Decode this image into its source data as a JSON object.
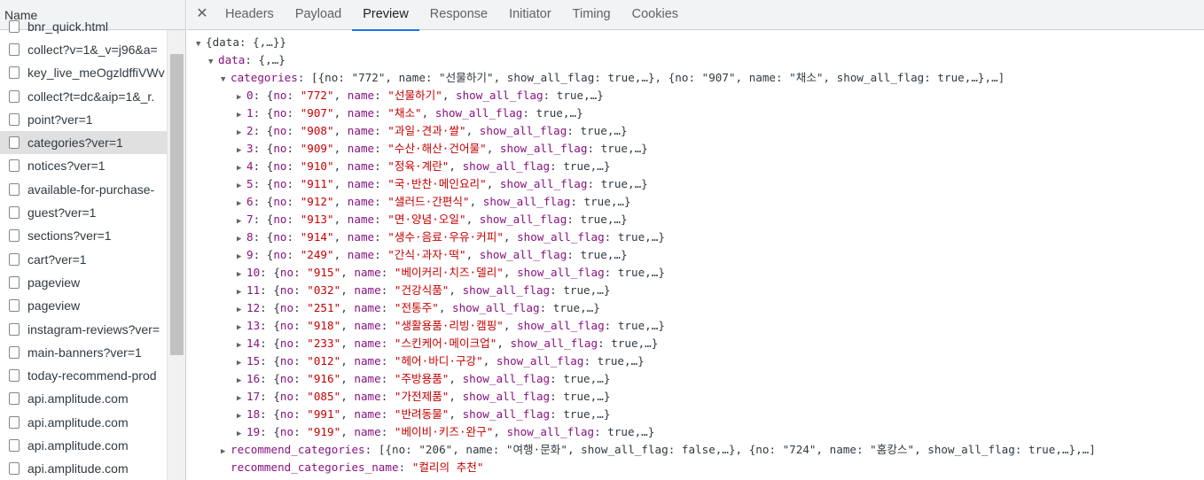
{
  "sidebar": {
    "header": "Name",
    "requests": [
      "bnr_quick.html",
      "collect?v=1&_v=j96&a=",
      "key_live_meOgzldffiVWv",
      "collect?t=dc&aip=1&_r.",
      "point?ver=1",
      "categories?ver=1",
      "notices?ver=1",
      "available-for-purchase-",
      "guest?ver=1",
      "sections?ver=1",
      "cart?ver=1",
      "pageview",
      "pageview",
      "instagram-reviews?ver=",
      "main-banners?ver=1",
      "today-recommend-prod",
      "api.amplitude.com",
      "api.amplitude.com",
      "api.amplitude.com",
      "api.amplitude.com"
    ],
    "selected_index": 5
  },
  "tabs": {
    "close": "✕",
    "items": [
      "Headers",
      "Payload",
      "Preview",
      "Response",
      "Initiator",
      "Timing",
      "Cookies"
    ],
    "active": "Preview"
  },
  "preview": {
    "root": "{data: {,…}}",
    "data_key": "data",
    "data_val": "{,…}",
    "categories_key": "categories",
    "categories_val": "[{no: \"772\", name: \"선물하기\", show_all_flag: true,…}, {no: \"907\", name: \"채소\", show_all_flag: true,…},…]",
    "items": [
      {
        "idx": "0",
        "no": "772",
        "name": "선물하기"
      },
      {
        "idx": "1",
        "no": "907",
        "name": "채소"
      },
      {
        "idx": "2",
        "no": "908",
        "name": "과일·견과·쌀"
      },
      {
        "idx": "3",
        "no": "909",
        "name": "수산·해산·건어물"
      },
      {
        "idx": "4",
        "no": "910",
        "name": "정육·계란"
      },
      {
        "idx": "5",
        "no": "911",
        "name": "국·반찬·메인요리"
      },
      {
        "idx": "6",
        "no": "912",
        "name": "샐러드·간편식"
      },
      {
        "idx": "7",
        "no": "913",
        "name": "면·양념·오일"
      },
      {
        "idx": "8",
        "no": "914",
        "name": "생수·음료·우유·커피"
      },
      {
        "idx": "9",
        "no": "249",
        "name": "간식·과자·떡"
      },
      {
        "idx": "10",
        "no": "915",
        "name": "베이커리·치즈·델리"
      },
      {
        "idx": "11",
        "no": "032",
        "name": "건강식품"
      },
      {
        "idx": "12",
        "no": "251",
        "name": "전통주"
      },
      {
        "idx": "13",
        "no": "918",
        "name": "생활용품·리빙·캠핑"
      },
      {
        "idx": "14",
        "no": "233",
        "name": "스킨케어·메이크업"
      },
      {
        "idx": "15",
        "no": "012",
        "name": "헤어·바디·구강"
      },
      {
        "idx": "16",
        "no": "916",
        "name": "주방용품"
      },
      {
        "idx": "17",
        "no": "085",
        "name": "가전제품"
      },
      {
        "idx": "18",
        "no": "991",
        "name": "반려동물"
      },
      {
        "idx": "19",
        "no": "919",
        "name": "베이비·키즈·완구"
      }
    ],
    "recommend_key": "recommend_categories",
    "recommend_val": "[{no: \"206\", name: \"여행·문화\", show_all_flag: false,…}, {no: \"724\", name: \"홈캉스\", show_all_flag: true,…},…]",
    "recommend_name_key": "recommend_categories_name",
    "recommend_name_val": "\"컬리의 추천\""
  }
}
